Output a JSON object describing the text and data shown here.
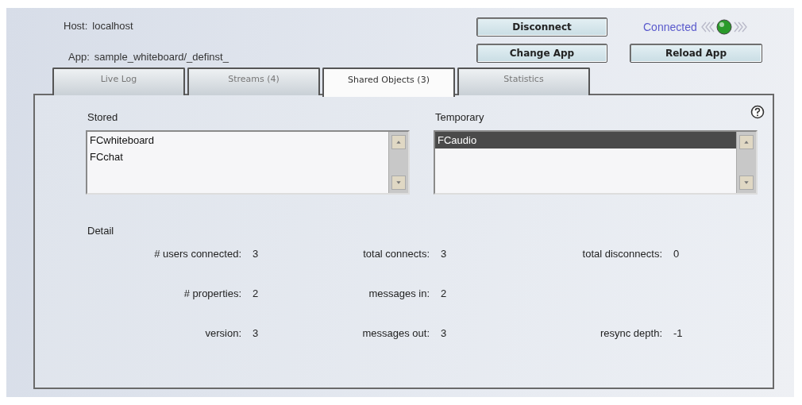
{
  "connection": {
    "host_label": "Host:",
    "host": "localhost",
    "app_label": "App:",
    "app": "sample_whiteboard/_definst_",
    "status": "Connected",
    "connected": true
  },
  "buttons": [
    {
      "label": "Disconnect"
    },
    {
      "label": "Change App"
    },
    {
      "label": "Reload App"
    }
  ],
  "tabs": [
    {
      "label": "Live Log",
      "selected": false
    },
    {
      "label": "Streams (4)",
      "selected": false
    },
    {
      "label": "Shared Objects (3)",
      "selected": true
    },
    {
      "label": "Statistics",
      "selected": false
    }
  ],
  "stored": {
    "label": "Stored",
    "items": [
      {
        "name": "FCwhiteboard",
        "selected": false
      },
      {
        "name": "FCchat",
        "selected": false
      }
    ]
  },
  "temporary": {
    "label": "Temporary",
    "items": [
      {
        "name": "FCaudio",
        "selected": true
      }
    ]
  },
  "detail": {
    "title": "Detail",
    "rows": [
      [
        {
          "label": "# users connected:",
          "value": "3"
        },
        {
          "label": "total connects:",
          "value": "3"
        },
        {
          "label": "total disconnects:",
          "value": "0"
        }
      ],
      [
        {
          "label": "# properties:",
          "value": "2"
        },
        {
          "label": "messages in:",
          "value": "2"
        },
        null
      ],
      [
        {
          "label": "version:",
          "value": "3"
        },
        {
          "label": "messages out:",
          "value": "3"
        },
        {
          "label": "resync depth:",
          "value": "-1"
        }
      ]
    ]
  }
}
